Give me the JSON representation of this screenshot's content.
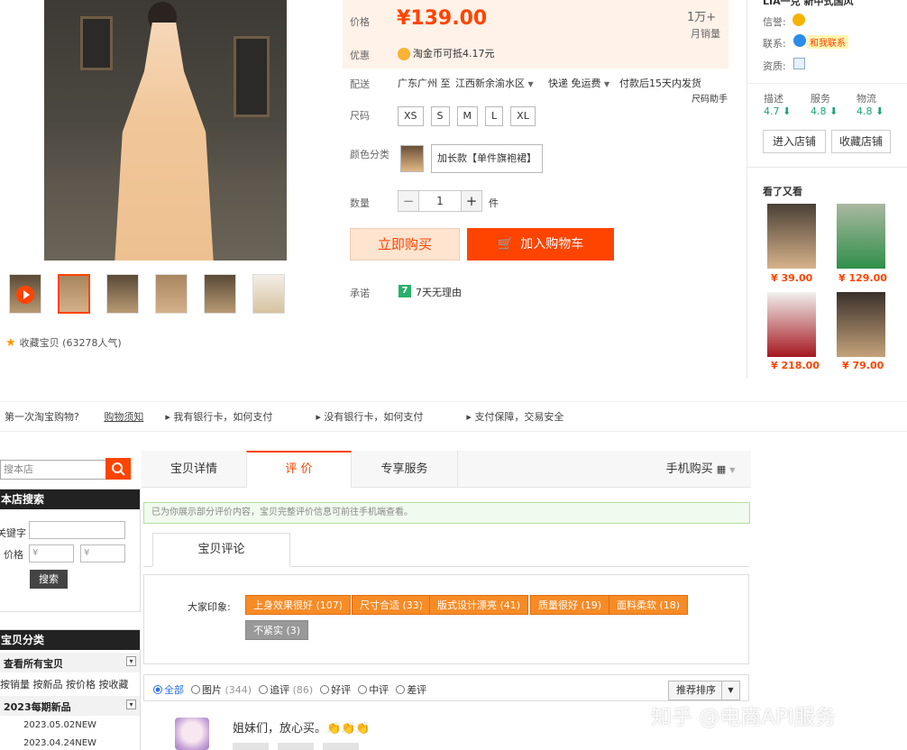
{
  "gallery": {
    "favorite_label": "收藏宝贝 (63278人气)"
  },
  "price_panel": {
    "price_label": "价格",
    "price": "¥139.00",
    "sales_num": "1万+",
    "sales_label": "月销量",
    "discount_label": "优惠",
    "discount_text": "淘金币可抵4.17元"
  },
  "delivery": {
    "label": "配送",
    "from": "广东广州 至",
    "to": "江西新余渝水区",
    "express": "快递 免运费",
    "ship": "付款后15天内发货",
    "size_helper": "尺码助手"
  },
  "size": {
    "label": "尺码",
    "options": [
      "XS",
      "S",
      "M",
      "L",
      "XL"
    ]
  },
  "color": {
    "label": "颜色分类",
    "option": "加长款【单件旗袍裙】"
  },
  "quantity": {
    "label": "数量",
    "value": "1",
    "unit": "件",
    "minus": "−",
    "plus": "+"
  },
  "actions": {
    "buy_now": "立即购买",
    "add_cart": "加入购物车"
  },
  "promise": {
    "label": "承诺",
    "badge": "7",
    "text": "7天无理由"
  },
  "shop": {
    "name_partial": "LIA一克 新中式国风",
    "credit_label": "信誉:",
    "contact_label": "联系:",
    "contact_btn": "和我联系",
    "qual_label": "资质:",
    "scores": [
      {
        "label": "描述",
        "value": "4.7"
      },
      {
        "label": "服务",
        "value": "4.8"
      },
      {
        "label": "物流",
        "value": "4.8"
      }
    ],
    "enter_btn": "进入店铺",
    "collect_btn": "收藏店铺",
    "also_viewed": "看了又看",
    "recs": [
      {
        "price": "¥ 39.00"
      },
      {
        "price": "¥ 129.00"
      },
      {
        "price": "¥ 218.00"
      },
      {
        "price": "¥ 79.00"
      }
    ]
  },
  "infobar": {
    "first": "第一次淘宝购物?",
    "first_link": "购物须知",
    "item2": "我有银行卡，如何支付",
    "item3": "没有银行卡，如何支付",
    "item4": "支付保障，交易安全"
  },
  "sidebar": {
    "search_placeholder": "搜本店",
    "search_head": "本店搜索",
    "keyword_label": "关键字",
    "price_label": "价格",
    "price_min_placeholder": "¥",
    "price_max_placeholder": "¥",
    "search_btn": "搜索",
    "cat_head": "宝贝分类",
    "all_items": "查看所有宝贝",
    "sort_links": "按销量 按新品 按价格 按收藏",
    "new_2023": "2023每期新品",
    "date1": "2023.05.02NEW",
    "date2": "2023.04.24NEW"
  },
  "tabs": {
    "detail": "宝贝详情",
    "review": "评 价",
    "service": "专享服务",
    "mobile": "手机购买"
  },
  "reviews": {
    "notice": "已为你展示部分评价内容，宝贝完整评价信息可前往手机端查看。",
    "tab": "宝贝评论",
    "impression_label": "大家印象:",
    "tags": [
      "上身效果很好 (107)",
      "尺寸合适 (33)",
      "版式设计漂亮 (41)",
      "质量很好 (19)",
      "面料柔软 (18)"
    ],
    "neg_tag": "不紧实 (3)",
    "filters": {
      "all": "全部",
      "pics": "图片",
      "pics_count": "(344)",
      "followup": "追评",
      "followup_count": "(86)",
      "good": "好评",
      "mid": "中评",
      "bad": "差评"
    },
    "sort": "推荐排序",
    "first_comment": "姐妹们，放心买。👏👏👏"
  },
  "watermark": "知乎 @电商API服务"
}
